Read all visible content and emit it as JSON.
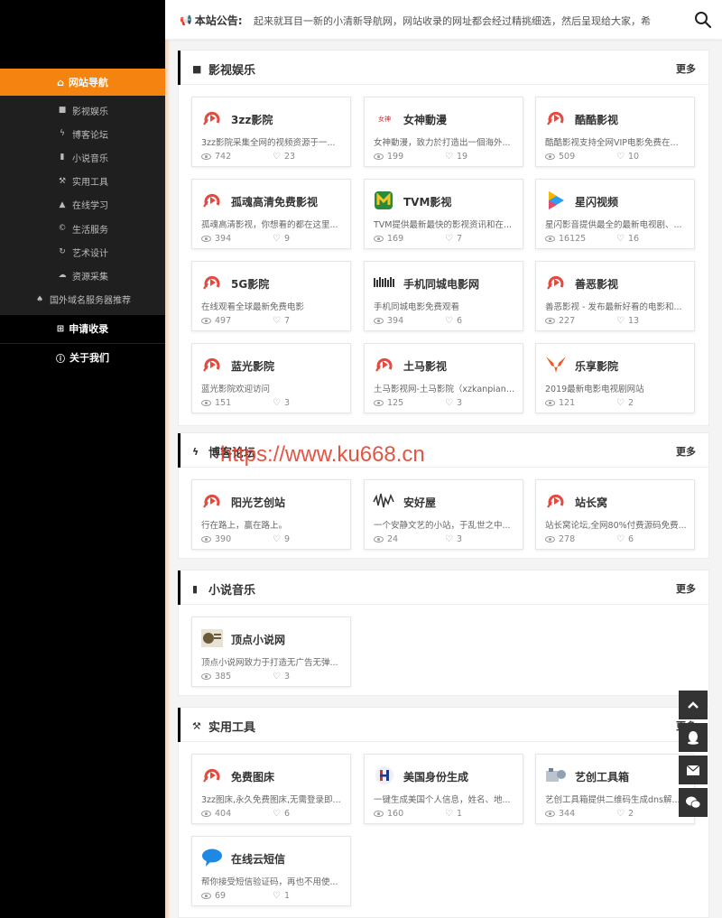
{
  "sidebar": {
    "main_nav": "网站导航",
    "items": [
      {
        "label": "影视娱乐",
        "icon": "video-icon"
      },
      {
        "label": "博客论坛",
        "icon": "bolt-icon"
      },
      {
        "label": "小说音乐",
        "icon": "book-icon"
      },
      {
        "label": "实用工具",
        "icon": "hammer-icon"
      },
      {
        "label": "在线学习",
        "icon": "graduation-icon"
      },
      {
        "label": "生活服务",
        "icon": "life-icon"
      },
      {
        "label": "艺术设计",
        "icon": "art-icon"
      },
      {
        "label": "资源采集",
        "icon": "cloud-icon"
      },
      {
        "label": "国外域名服务器推荐",
        "icon": "bell-icon"
      }
    ],
    "apply": "申请收录",
    "about": "关于我们"
  },
  "topbar": {
    "notice_label": "本站公告:",
    "notice_text": "起来就耳目一新的小清新导航网，网站收录的网址都会经过精挑细选，然后呈现给大家，希"
  },
  "watermark": "https://www.ku668.cn",
  "sections": {
    "video": {
      "title": "影视娱乐",
      "more": "更多",
      "cards": [
        {
          "name": "3zz影院",
          "desc": "3zz影院采集全网的视频资源于一...",
          "views": "742",
          "likes": "23"
        },
        {
          "name": "女神動漫",
          "desc": "女神動漫，致力於打造出一個海外...",
          "views": "199",
          "likes": "19"
        },
        {
          "name": "酷酷影视",
          "desc": "酷酷影视支持全网VIP电影免费在...",
          "views": "509",
          "likes": "10"
        },
        {
          "name": "孤魂高清免费影视",
          "desc": "孤魂高清影视，你想看的都在这里...",
          "views": "394",
          "likes": "9"
        },
        {
          "name": "TVM影视",
          "desc": "TVM提供最新最快的影视资讯和在...",
          "views": "169",
          "likes": "7"
        },
        {
          "name": "星闪视频",
          "desc": "星闪影音提供最全的最新电视剧、...",
          "views": "16125",
          "likes": "16"
        },
        {
          "name": "5G影院",
          "desc": "在线观看全球最新免费电影",
          "views": "497",
          "likes": "7"
        },
        {
          "name": "手机同城电影网",
          "desc": "手机同城电影免费观看",
          "views": "394",
          "likes": "6"
        },
        {
          "name": "善恶影视",
          "desc": "善恶影视 - 发布最新好看的电影和...",
          "views": "227",
          "likes": "13"
        },
        {
          "name": "蓝光影院",
          "desc": "蓝光影院欢迎访问",
          "views": "151",
          "likes": "3"
        },
        {
          "name": "土马影视",
          "desc": "土马影视网-土马影院（xzkanpian....",
          "views": "125",
          "likes": "3"
        },
        {
          "name": "乐享影院",
          "desc": "2019最新电影电视剧网站",
          "views": "121",
          "likes": "2"
        }
      ]
    },
    "blog": {
      "title": "博客论坛",
      "more": "更多",
      "cards": [
        {
          "name": "阳光艺创站",
          "desc": "行在路上，赢在路上。",
          "views": "390",
          "likes": "9"
        },
        {
          "name": "安好屋",
          "desc": "一个安静文艺的小站，于乱世之中...",
          "views": "24",
          "likes": "3"
        },
        {
          "name": "站长窝",
          "desc": "站长窝论坛,全网80%付费源码免费...",
          "views": "278",
          "likes": "6"
        }
      ]
    },
    "novel": {
      "title": "小说音乐",
      "more": "更多",
      "cards": [
        {
          "name": "顶点小说网",
          "desc": "顶点小说网致力于打造无广告无弹...",
          "views": "385",
          "likes": "3"
        }
      ]
    },
    "tools": {
      "title": "实用工具",
      "more": "更多",
      "cards": [
        {
          "name": "免费图床",
          "desc": "3zz图床,永久免费图床,无需登录即...",
          "views": "404",
          "likes": "6"
        },
        {
          "name": "美国身份生成",
          "desc": "一键生成美国个人信息，姓名、地...",
          "views": "160",
          "likes": "1"
        },
        {
          "name": "艺创工具箱",
          "desc": "艺创工具箱提供二维码生成dns解...",
          "views": "344",
          "likes": "2"
        },
        {
          "name": "在线云短信",
          "desc": "帮你接受短信验证码，再也不用使...",
          "views": "69",
          "likes": "1"
        }
      ]
    }
  }
}
